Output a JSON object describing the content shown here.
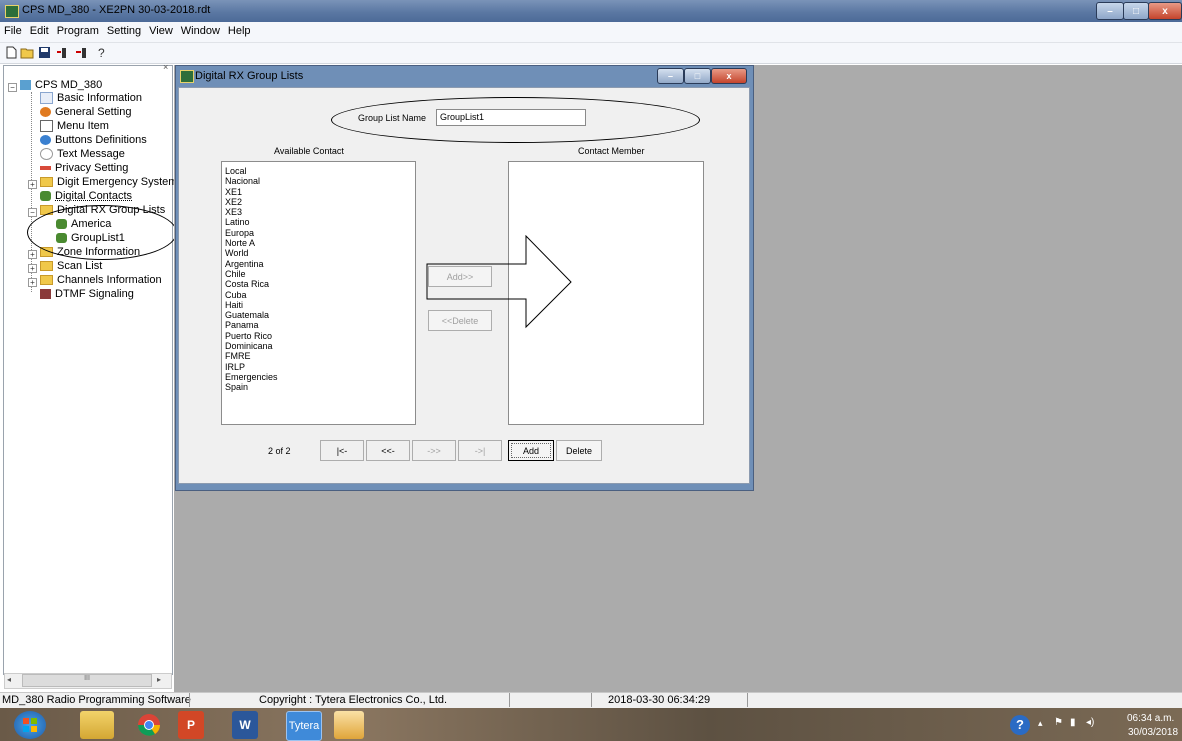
{
  "window": {
    "title": "CPS MD_380 - XE2PN 30-03-2018.rdt",
    "controls": [
      "–",
      "□",
      "x"
    ]
  },
  "menu": [
    "File",
    "Edit",
    "Program",
    "Setting",
    "View",
    "Window",
    "Help"
  ],
  "toolbar": {
    "icons": [
      "new-file-icon",
      "open-folder-icon",
      "save-icon",
      "read-radio-icon",
      "write-radio-icon",
      "help-icon"
    ],
    "tree_close": "×"
  },
  "tree": {
    "root": "CPS MD_380",
    "items": [
      {
        "label": "Basic Information",
        "icon": "document-icon"
      },
      {
        "label": "General Setting",
        "icon": "settings-icon"
      },
      {
        "label": "Menu Item",
        "icon": "menu-icon"
      },
      {
        "label": "Buttons Definitions",
        "icon": "button-icon"
      },
      {
        "label": "Text Message",
        "icon": "message-icon"
      },
      {
        "label": "Privacy Setting",
        "icon": "privacy-icon"
      },
      {
        "label": "Digit Emergency System",
        "icon": "folder-icon"
      },
      {
        "label": "Digital Contacts",
        "icon": "contacts-icon"
      },
      {
        "label": "Digital RX Group Lists",
        "icon": "folder-icon"
      },
      {
        "label": "America",
        "icon": "group-icon"
      },
      {
        "label": "GroupList1",
        "icon": "group-icon"
      },
      {
        "label": "Zone Information",
        "icon": "folder-icon"
      },
      {
        "label": "Scan List",
        "icon": "folder-icon"
      },
      {
        "label": "Channels Information",
        "icon": "folder-icon"
      },
      {
        "label": "DTMF Signaling",
        "icon": "dtmf-icon"
      }
    ],
    "scroll_thumb": "III"
  },
  "dialog": {
    "title": "Digital RX Group Lists",
    "group_list_name_label": "Group List Name",
    "group_list_name_value": "GroupList1",
    "available_label": "Available Contact",
    "member_label": "Contact Member",
    "available_contacts": [
      "Local",
      "Nacional",
      "XE1",
      "XE2",
      "XE3",
      "Latino",
      "Europa",
      "Norte A",
      "World",
      "Argentina",
      "Chile",
      "Costa Rica",
      "Cuba",
      "Haiti",
      "Guatemala",
      "Panama",
      "Puerto Rico",
      "Dominicana",
      "FMRE",
      "IRLP",
      "Emergencies",
      "Spain"
    ],
    "add_button": "Add>>",
    "delete_button": "<<Delete",
    "page_indicator": "2 of 2",
    "nav_first": "|<-",
    "nav_prev": "<<-",
    "nav_next": "->>",
    "nav_last": "->|",
    "add_list": "Add",
    "delete_list": "Delete"
  },
  "status": {
    "app": "MD_380 Radio Programming Software",
    "copyright": "Copyright : Tytera Electronics Co., Ltd.",
    "datetime": "2018-03-30 06:34:29"
  },
  "taskbar": {
    "apps": [
      "start-button",
      "file-explorer-icon",
      "chrome-icon",
      "powerpoint-icon",
      "word-icon",
      "tytera-icon",
      "paint-icon"
    ],
    "tytera_label": "Tytera",
    "time": "06:34 a.m.",
    "date": "30/03/2018"
  }
}
